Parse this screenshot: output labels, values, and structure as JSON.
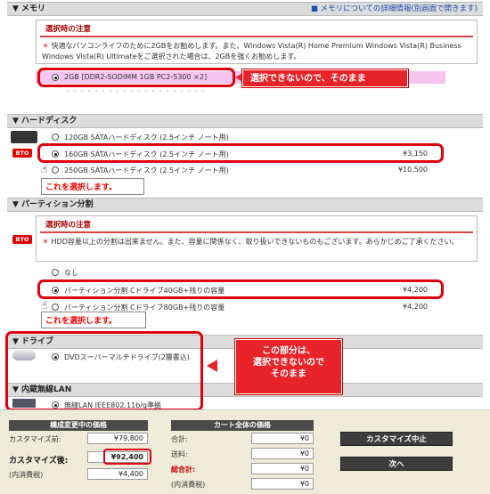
{
  "memory": {
    "header": "▼ メモリ",
    "detail_link": "■ メモリについての詳細情報(別画面で開きます)",
    "notice_title": "選択時の注意",
    "notice_mark": "＊",
    "notice_body": "快適なパソコンライフのために2GBをお勧めします。また、Windows Vista(R) Home Premium Windows Vista(R) Business Windows Vista(R) Ultimateをご選択された場合は、2GBを強くお勧めします。",
    "option_label": "2GB [DDR2-SODIMM 1GB PC2-5300 ×2]",
    "callout": "選択できないので、そのまま"
  },
  "hdd": {
    "header": "▼ ハードディスク",
    "bto": "BTO",
    "options": [
      {
        "label": "120GB SATAハードディスク (2.5インチ ノート用)",
        "price": ""
      },
      {
        "label": "160GB SATAハードディスク (2.5インチ ノート用)",
        "price": "¥3,150"
      },
      {
        "label": "250GB SATAハードディスク (2.5インチ ノート用)",
        "price": "¥10,500"
      }
    ],
    "callout": "これを選択します。"
  },
  "partition": {
    "header": "▼ パーティション分割",
    "bto": "BTO",
    "notice_title": "選択時の注意",
    "notice_mark": "＊",
    "notice_body": "HDD容量以上の分割は出来ません。また、容量に関係なく、取り扱いできないものもございます。あらかじめご了承ください。",
    "options": [
      {
        "label": "なし",
        "price": ""
      },
      {
        "label": "パーティション分割 Cドライブ40GB+残りの容量",
        "price": "¥4,200"
      },
      {
        "label": "パーティション分割 Cドライブ80GB+残りの容量",
        "price": "¥4,200"
      }
    ],
    "callout": "これを選択します。"
  },
  "drive": {
    "header": "▼ ドライブ",
    "option_label": "DVDスーパーマルチドライブ(2層書込)"
  },
  "lan": {
    "header": "▼ 内蔵無線LAN",
    "option_label": "無線LAN IEEE802.11b/g準拠"
  },
  "note_callout": {
    "line1": "この部分は、",
    "line2": "選択できないので",
    "line3": "そのまま"
  },
  "summary": {
    "panel1_title": "構成変更中の価格",
    "before_label": "カスタマイズ前:",
    "before_value": "¥79,800",
    "after_label": "カスタマイズ後:",
    "after_value": "¥92,400",
    "tax_label": "(内消費税)",
    "tax_value": "¥4,400",
    "panel2_title": "カート全体の価格",
    "subtotal_label": "合計:",
    "subtotal_value": "¥0",
    "shipping_label": "送料:",
    "shipping_value": "¥0",
    "total_label": "総合計:",
    "total_value": "¥0",
    "total_tax_label": "(内消費税)",
    "total_tax_value": "¥0",
    "cancel_button": "カスタマイズ中止",
    "next_button": "次へ"
  }
}
